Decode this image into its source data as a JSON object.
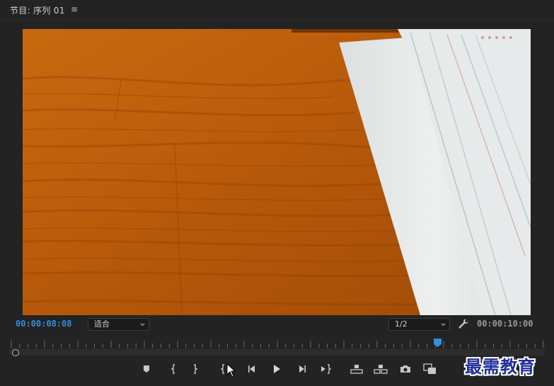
{
  "panel": {
    "title": "节目: 序列 01",
    "menu_icon": "hamburger-menu-icon"
  },
  "viewer": {
    "current_timecode": "00:00:08:08",
    "duration_timecode": "00:00:10:00",
    "fit_select": {
      "value": "适合"
    },
    "resolution_select": {
      "value": "1/2"
    },
    "settings_icon": "wrench-icon"
  },
  "timeline": {
    "playhead_progress": 0.8
  },
  "controls": [
    {
      "name": "add-marker-button",
      "icon": "marker-icon"
    },
    {
      "name": "mark-in-button",
      "icon": "mark-in-icon"
    },
    {
      "name": "mark-out-button",
      "icon": "mark-out-icon"
    },
    {
      "name": "go-to-in-button",
      "icon": "go-to-in-icon"
    },
    {
      "name": "step-back-button",
      "icon": "step-back-icon"
    },
    {
      "name": "play-button",
      "icon": "play-icon"
    },
    {
      "name": "step-forward-button",
      "icon": "step-forward-icon"
    },
    {
      "name": "go-to-out-button",
      "icon": "go-to-out-icon"
    },
    {
      "name": "lift-button",
      "icon": "lift-icon"
    },
    {
      "name": "extract-button",
      "icon": "extract-icon"
    },
    {
      "name": "export-frame-button",
      "icon": "camera-icon"
    },
    {
      "name": "compare-view-button",
      "icon": "comparison-icon"
    }
  ],
  "colors": {
    "timecode_accent": "#2f8fe0",
    "playhead": "#2f8fe0",
    "panel_bg": "#232323"
  },
  "watermark": "最需教育"
}
